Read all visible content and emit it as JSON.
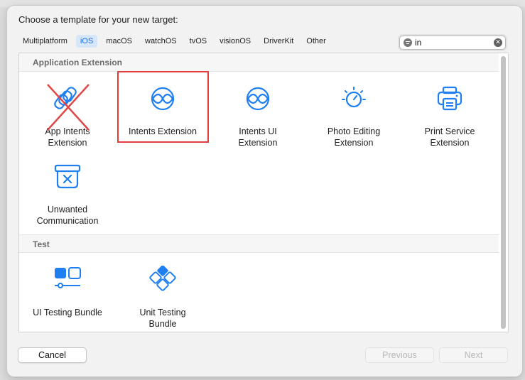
{
  "dialog": {
    "title": "Choose a template for your new target:"
  },
  "platform_tabs": [
    {
      "label": "Multiplatform",
      "active": false
    },
    {
      "label": "iOS",
      "active": true
    },
    {
      "label": "macOS",
      "active": false
    },
    {
      "label": "watchOS",
      "active": false
    },
    {
      "label": "tvOS",
      "active": false
    },
    {
      "label": "visionOS",
      "active": false
    },
    {
      "label": "DriverKit",
      "active": false
    },
    {
      "label": "Other",
      "active": false
    }
  ],
  "search": {
    "value": "in",
    "filter_icon": "filter-icon",
    "clear_icon": "clear-icon"
  },
  "sections": [
    {
      "header": "Application Extension",
      "items": [
        {
          "label": "App Intents\nExtension",
          "icon": "app-intents-icon",
          "crossed_out": true
        },
        {
          "label": "Intents Extension",
          "icon": "intents-icon",
          "highlighted": true
        },
        {
          "label": "Intents UI\nExtension",
          "icon": "intents-ui-icon"
        },
        {
          "label": "Photo Editing\nExtension",
          "icon": "photo-editing-icon"
        },
        {
          "label": "Print Service\nExtension",
          "icon": "printer-icon"
        },
        {
          "label": "Unwanted\nCommunication",
          "icon": "unwanted-communication-icon"
        }
      ]
    },
    {
      "header": "Test",
      "items": [
        {
          "label": "UI Testing Bundle",
          "icon": "ui-testing-icon"
        },
        {
          "label": "Unit Testing\nBundle",
          "icon": "unit-testing-icon"
        }
      ]
    }
  ],
  "buttons": {
    "cancel": "Cancel",
    "previous": "Previous",
    "next": "Next"
  },
  "colors": {
    "accent": "#1f7ef0",
    "highlight": "#e33d3d",
    "cross": "#e04848"
  }
}
